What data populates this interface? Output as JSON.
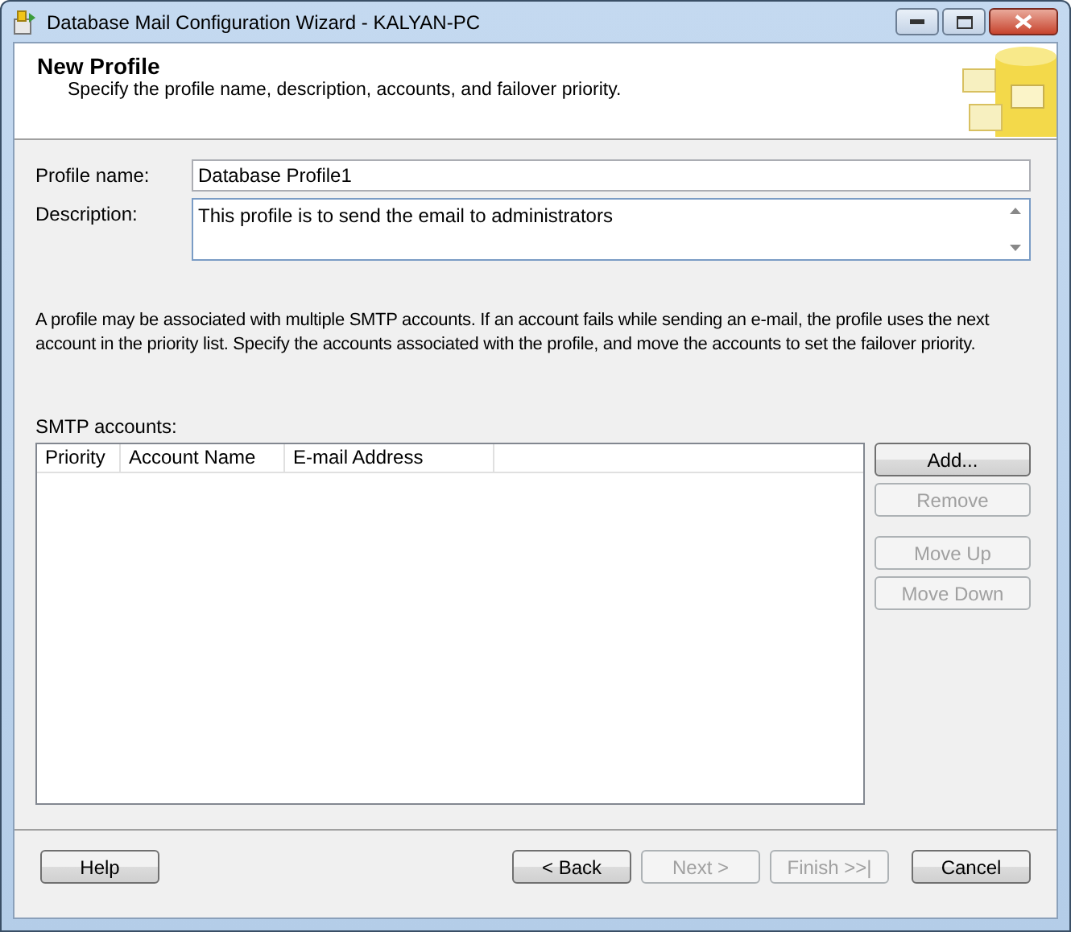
{
  "window": {
    "title": "Database Mail Configuration Wizard - KALYAN-PC"
  },
  "header": {
    "title": "New Profile",
    "subtitle": "Specify the profile name, description, accounts, and failover priority."
  },
  "profile_name": {
    "label": "Profile name:",
    "value": "Database Profile1"
  },
  "description": {
    "label": "Description:",
    "value": "This profile is to send the email to administrators"
  },
  "info_text": "A profile may be associated with multiple SMTP accounts. If an account fails while sending an e-mail, the profile uses the next account in the priority list. Specify the accounts associated with the profile, and move the accounts to set the failover priority.",
  "smtp_accounts": {
    "label": "SMTP accounts:",
    "columns": [
      "Priority",
      "Account Name",
      "E-mail Address"
    ]
  },
  "side_buttons": [
    {
      "label": "Add...",
      "disabled": false
    },
    {
      "label": "Remove",
      "disabled": true
    },
    {
      "label": "Move Up",
      "disabled": true
    },
    {
      "label": "Move Down",
      "disabled": true
    }
  ],
  "help_button": {
    "label": "Help",
    "disabled": false
  },
  "nav_buttons": [
    {
      "label": "< Back",
      "disabled": false
    },
    {
      "label": "Next >",
      "disabled": true
    },
    {
      "label": "Finish >>|",
      "disabled": true
    },
    {
      "label": "Cancel",
      "disabled": false
    }
  ]
}
